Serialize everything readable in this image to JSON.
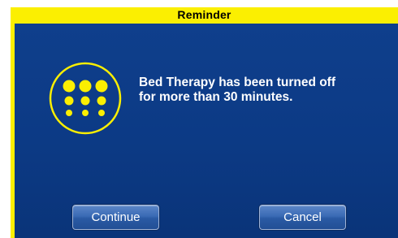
{
  "dialog": {
    "title": "Reminder",
    "icon": "bed-therapy-dots-icon",
    "message_line1": "Bed Therapy has been turned off",
    "message_line2": "for more than 30 minutes.",
    "buttons": {
      "continue_label": "Continue",
      "cancel_label": "Cancel"
    }
  },
  "colors": {
    "accent_yellow": "#fbef01",
    "panel_blue": "#0c3a87",
    "button_blue": "#3a6bb5",
    "text_white": "#ffffff"
  }
}
